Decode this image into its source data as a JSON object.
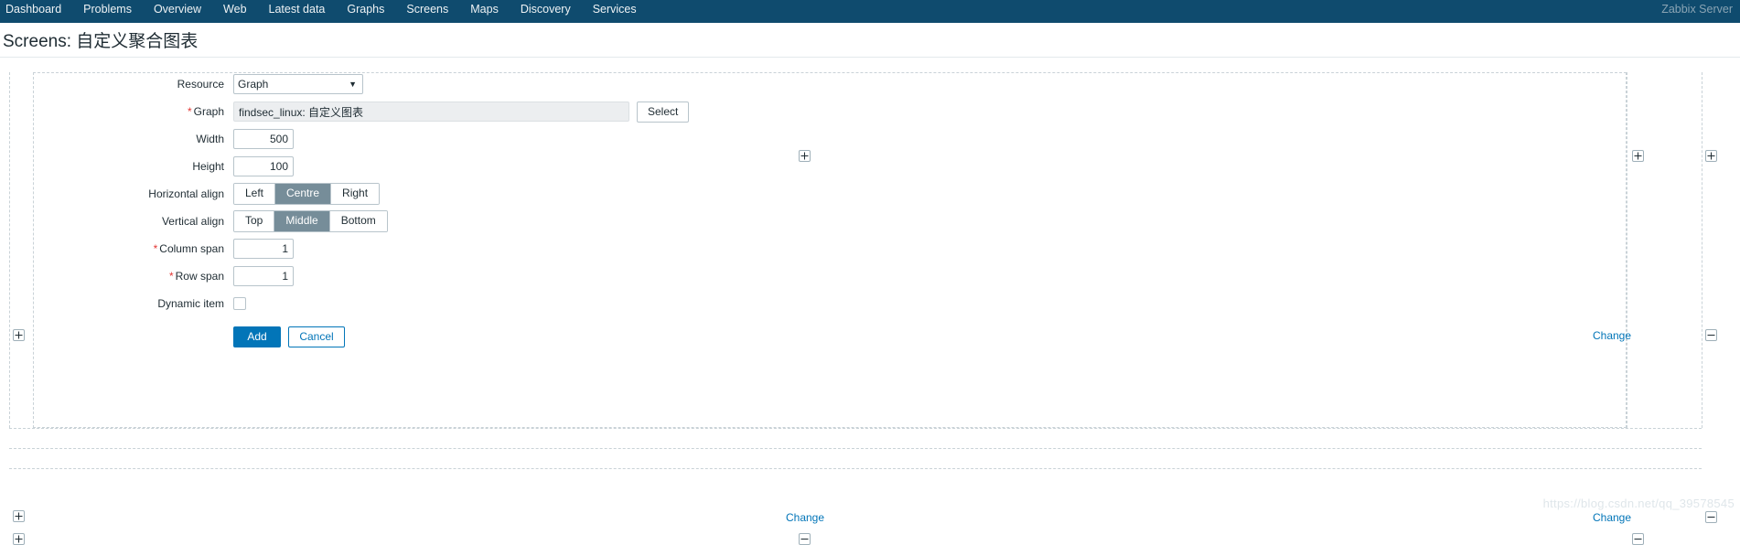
{
  "nav": {
    "items": [
      {
        "label": "Dashboard",
        "active": false
      },
      {
        "label": "Problems",
        "active": false
      },
      {
        "label": "Overview",
        "active": false
      },
      {
        "label": "Web",
        "active": false
      },
      {
        "label": "Latest data",
        "active": false
      },
      {
        "label": "Graphs",
        "active": false
      },
      {
        "label": "Screens",
        "active": true
      },
      {
        "label": "Maps",
        "active": false
      },
      {
        "label": "Discovery",
        "active": false
      },
      {
        "label": "Services",
        "active": false
      }
    ],
    "user_label": "Zabbix Server"
  },
  "header": {
    "title": "Screens: 自定义聚合图表"
  },
  "form": {
    "resource": {
      "label": "Resource",
      "value": "Graph",
      "options": [
        "Graph"
      ]
    },
    "graph": {
      "label": "Graph",
      "required": true,
      "value": "findsec_linux: 自定义图表",
      "placeholder": "",
      "select_button": "Select"
    },
    "width": {
      "label": "Width",
      "value": "500"
    },
    "height": {
      "label": "Height",
      "value": "100"
    },
    "horizontal_align": {
      "label": "Horizontal align",
      "options": [
        "Left",
        "Centre",
        "Right"
      ],
      "selected": "Centre"
    },
    "vertical_align": {
      "label": "Vertical align",
      "options": [
        "Top",
        "Middle",
        "Bottom"
      ],
      "selected": "Middle"
    },
    "column_span": {
      "label": "Column span",
      "required": true,
      "value": "1"
    },
    "row_span": {
      "label": "Row span",
      "required": true,
      "value": "1"
    },
    "dynamic_item": {
      "label": "Dynamic item",
      "checked": false
    },
    "actions": {
      "add": "Add",
      "cancel": "Cancel"
    }
  },
  "grid": {
    "change_link": "Change",
    "add_icon": "plus-icon",
    "remove_icon": "minus-icon"
  },
  "watermark": "https://blog.csdn.net/qq_39578545",
  "colors": {
    "nav_bg": "#0f4b6e",
    "accent": "#0275b8",
    "active_tab": "#76b9e0",
    "required": "#e33734",
    "segment_selected": "#768d99"
  }
}
